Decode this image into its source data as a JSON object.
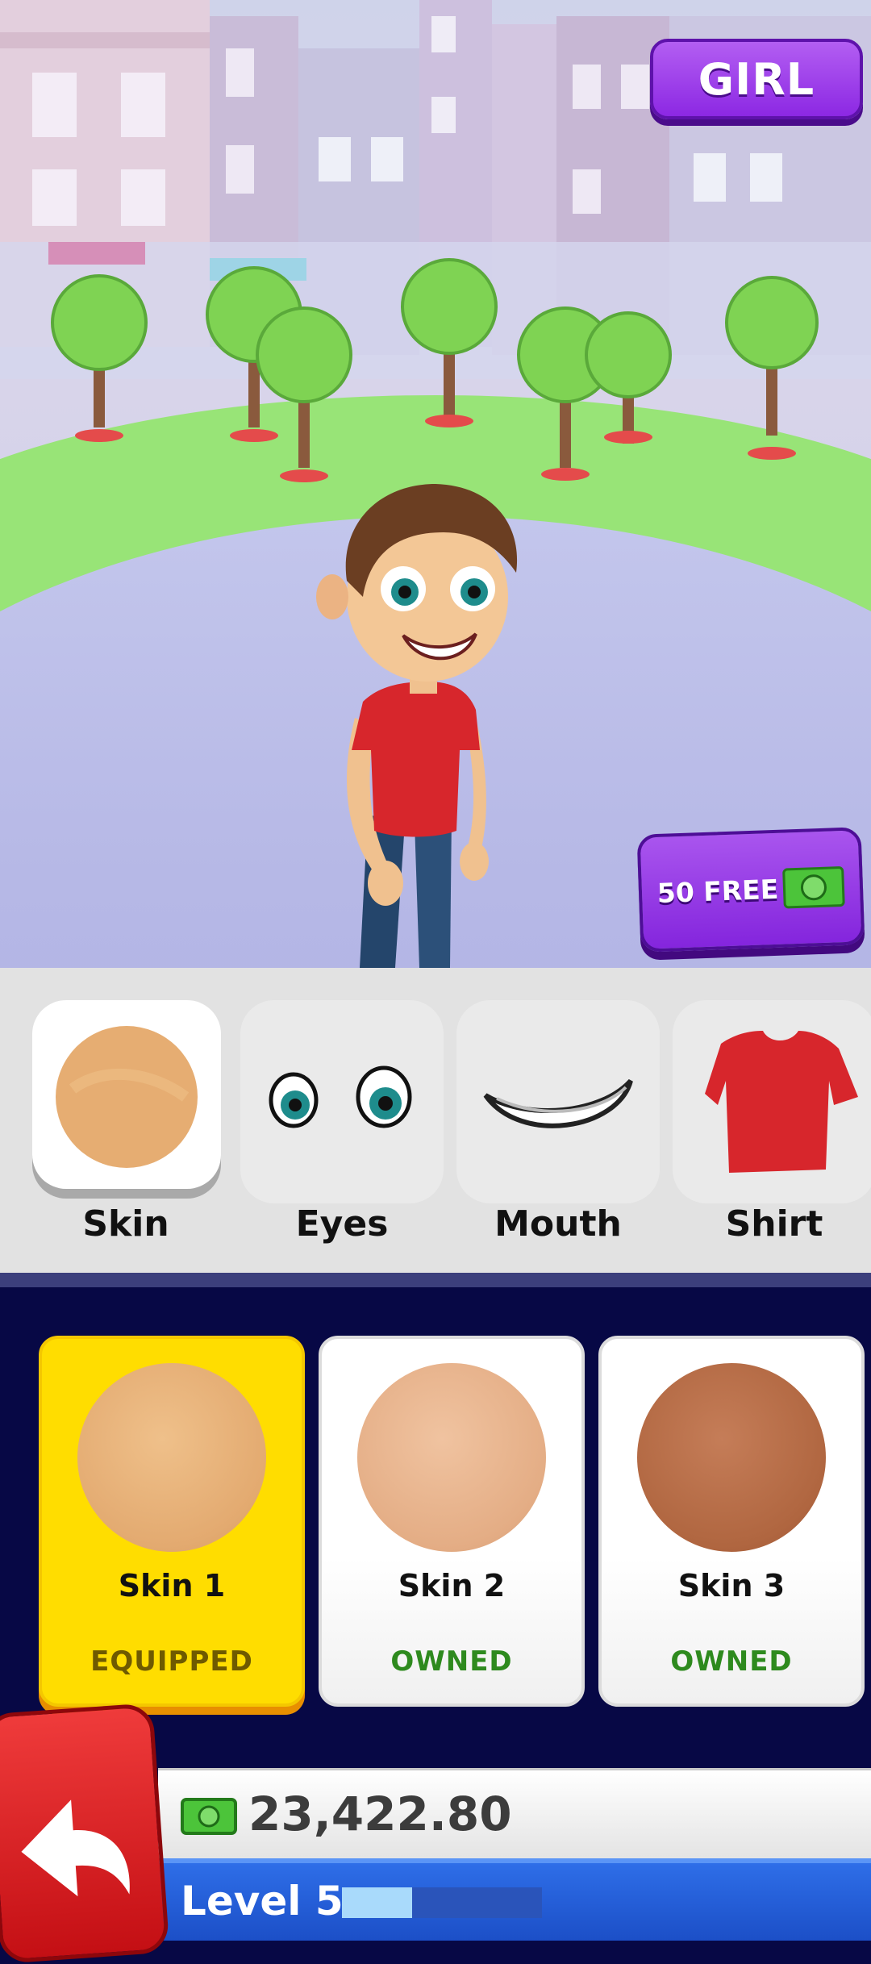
{
  "scene": {
    "gender_button": "GIRL",
    "free_offer_button": "50 FREE"
  },
  "categories": [
    {
      "label": "Skin",
      "active": true
    },
    {
      "label": "Eyes",
      "active": false
    },
    {
      "label": "Mouth",
      "active": false
    },
    {
      "label": "Shirt",
      "active": false
    }
  ],
  "items": [
    {
      "name": "Skin 1",
      "status": "EQUIPPED",
      "color": "#e9b27a"
    },
    {
      "name": "Skin 2",
      "status": "OWNED",
      "color": "#e7b08a"
    },
    {
      "name": "Skin 3",
      "status": "OWNED",
      "color": "#b36847"
    }
  ],
  "hud": {
    "money": "23,422.80",
    "level_label": "Level 5",
    "level_progress": 0.35
  },
  "colors": {
    "accent_purple": "#8c28e3",
    "equipped_yellow": "#ffdd00",
    "owned_green": "#2e8a1e",
    "back_red": "#e02a2a",
    "level_blue": "#2e6ee8"
  },
  "icons": {
    "back": "back-arrow-icon",
    "cash": "cash-icon"
  }
}
